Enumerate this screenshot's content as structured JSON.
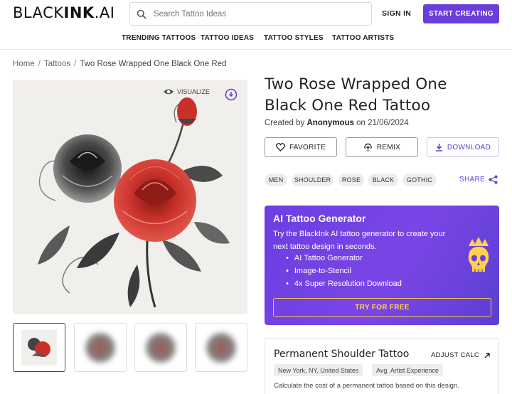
{
  "brand": {
    "logo_light": "BLACK",
    "logo_bold": "INK",
    "logo_suffix": ".AI"
  },
  "search": {
    "placeholder": "Search Tattoo Ideas"
  },
  "header": {
    "signin_label": "SIGN IN",
    "cta_label": "START CREATING"
  },
  "nav": [
    "TRENDING TATTOOS",
    "TATTOO IDEAS",
    "TATTOO STYLES",
    "TATTOO ARTISTS"
  ],
  "breadcrumb": {
    "home": "Home",
    "section": "Tattoos",
    "current": "Two Rose Wrapped One Black One Red"
  },
  "image": {
    "visualize_label": "VISUALIZE"
  },
  "tattoo": {
    "title": "Two Rose Wrapped One Black One Red Tattoo",
    "created_prefix": "Created by",
    "author": "Anonymous",
    "date_prefix": "on",
    "date": "21/06/2024"
  },
  "actions": {
    "favorite": "FAVORITE",
    "remix": "REMIX",
    "download": "DOWNLOAD",
    "share": "SHARE"
  },
  "tags": [
    "MEN",
    "SHOULDER",
    "ROSE",
    "BLACK",
    "GOTHIC"
  ],
  "promo": {
    "title": "AI Tattoo Generator",
    "description": "Try the BlackInk AI tattoo generator to create your next tattoo design in seconds.",
    "features": [
      "AI Tattoo Generator",
      "Image-to-Stencil",
      "4x Super Resolution Download"
    ],
    "cta": "TRY FOR FREE"
  },
  "calc": {
    "title": "Permanent Shoulder Tattoo",
    "adjust_label": "ADJUST CALC",
    "location": "New York, NY, United States",
    "experience": "Avg. Artist Experience",
    "note": "Calculate the cost of a permanent tattoo based on this design."
  },
  "colors": {
    "accent": "#6a3ed9",
    "rose_red": "#c8302a",
    "promo_gold": "#ffd24a"
  }
}
